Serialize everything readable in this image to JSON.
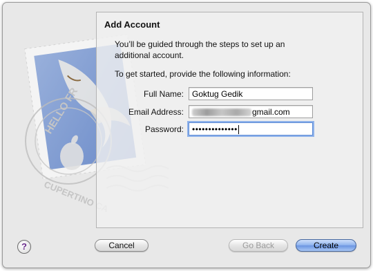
{
  "dialog": {
    "title": "Add Account",
    "intro": "You’ll be guided through the steps to set up an additional account.",
    "prompt": "To get started, provide the following information:"
  },
  "form": {
    "full_name_label": "Full Name:",
    "full_name_value": "Goktug Gedik",
    "email_label": "Email Address:",
    "email_visible_suffix": "gmail.com",
    "password_label": "Password:",
    "password_mask": "••••••••••••••"
  },
  "stamp": {
    "postmark_text_top": "HELLO FR",
    "postmark_text_bottom": "CUPERTINO CA"
  },
  "buttons": {
    "help": "?",
    "cancel": "Cancel",
    "go_back": "Go Back",
    "create": "Create"
  },
  "colors": {
    "accent": "#6b95e2",
    "focus_ring": "#8fb2ea"
  }
}
